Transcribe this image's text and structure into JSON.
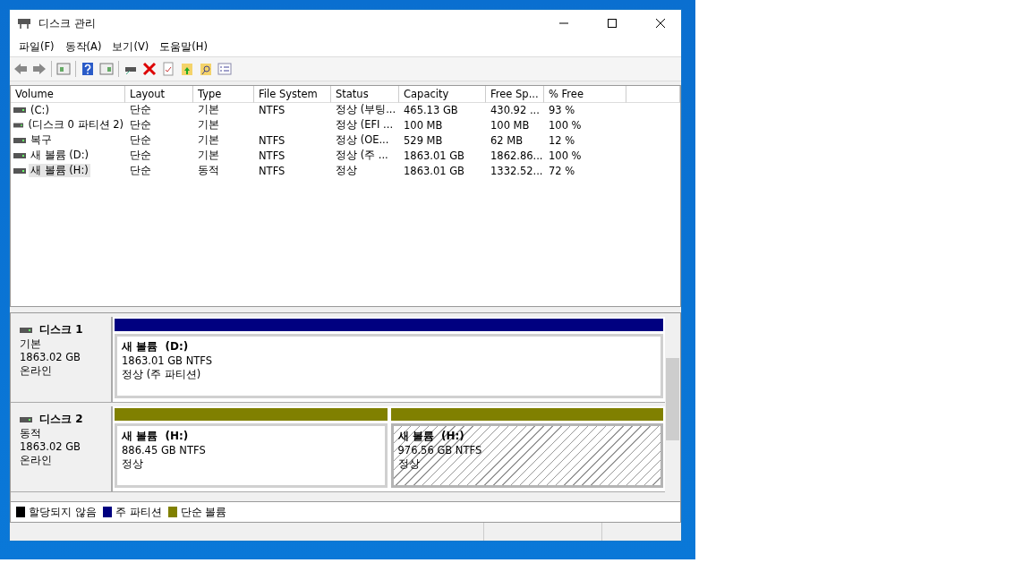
{
  "window": {
    "title": "디스크 관리"
  },
  "menu": [
    "파일(F)",
    "동작(A)",
    "보기(V)",
    "도움말(H)"
  ],
  "table": {
    "columns": [
      "Volume",
      "Layout",
      "Type",
      "File System",
      "Status",
      "Capacity",
      "Free Sp...",
      "% Free"
    ],
    "rows": [
      {
        "selected": false,
        "cells": [
          "(C:)",
          "단순",
          "기본",
          "NTFS",
          "정상 (부팅...",
          "465.13 GB",
          "430.92 ...",
          "93 %"
        ]
      },
      {
        "selected": false,
        "cells": [
          "(디스크 0 파티션 2)",
          "단순",
          "기본",
          "",
          "정상 (EFI ...",
          "100 MB",
          "100 MB",
          "100 %"
        ]
      },
      {
        "selected": false,
        "cells": [
          "복구",
          "단순",
          "기본",
          "NTFS",
          "정상 (OE...",
          "529 MB",
          "62 MB",
          "12 %"
        ]
      },
      {
        "selected": false,
        "cells": [
          "새 볼륨 (D:)",
          "단순",
          "기본",
          "NTFS",
          "정상 (주 ...",
          "1863.01 GB",
          "1862.86...",
          "100 %"
        ]
      },
      {
        "selected": true,
        "cells": [
          "새 볼륨 (H:)",
          "단순",
          "동적",
          "NTFS",
          "정상",
          "1863.01 GB",
          "1332.52...",
          "72 %"
        ]
      }
    ]
  },
  "disks": [
    {
      "name": "디스크 1",
      "type": "기본",
      "size": "1863.02 GB",
      "status": "온라인",
      "partitions": [
        {
          "name": "새 볼륨  (D:)",
          "size": "1863.01 GB NTFS",
          "status": "정상 (주 파티션)",
          "color": "#000080",
          "selected": false
        }
      ]
    },
    {
      "name": "디스크 2",
      "type": "동적",
      "size": "1863.02 GB",
      "status": "온라인",
      "partitions": [
        {
          "name": "새 볼륨  (H:)",
          "size": "886.45 GB NTFS",
          "status": "정상",
          "color": "#808000",
          "selected": false
        },
        {
          "name": "새 볼륨  (H:)",
          "size": "976.56 GB NTFS",
          "status": "정상",
          "color": "#808000",
          "selected": true
        }
      ]
    }
  ],
  "legend": [
    {
      "label": "할당되지 않음",
      "color": "#000000"
    },
    {
      "label": "주 파티션",
      "color": "#000080"
    },
    {
      "label": "단순 볼륨",
      "color": "#808000"
    }
  ]
}
